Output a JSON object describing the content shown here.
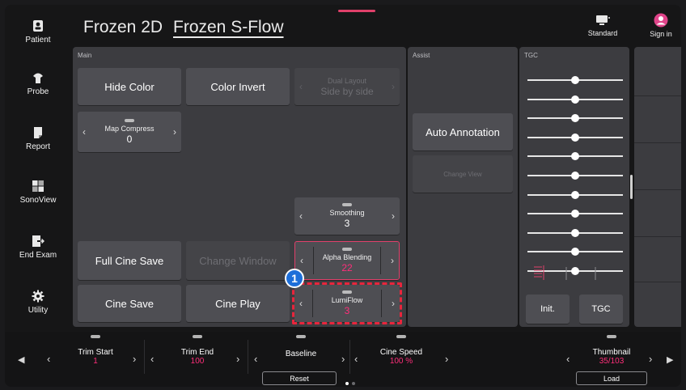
{
  "header": {
    "tabs": [
      {
        "label": "Frozen 2D",
        "active": false
      },
      {
        "label": "Frozen S-Flow",
        "active": true
      }
    ],
    "standard_label": "Standard",
    "signin_label": "Sign in"
  },
  "sidebar": {
    "items": [
      {
        "label": "Patient",
        "icon": "patient-icon"
      },
      {
        "label": "Probe",
        "icon": "probe-icon"
      },
      {
        "label": "Report",
        "icon": "report-icon"
      },
      {
        "label": "SonoView",
        "icon": "sonoview-icon"
      },
      {
        "label": "End Exam",
        "icon": "end-exam-icon"
      },
      {
        "label": "Utility",
        "icon": "gear-icon"
      }
    ]
  },
  "main": {
    "label": "Main",
    "hide_color": "Hide Color",
    "color_invert": "Color Invert",
    "dual_layout": {
      "label": "Dual Layout",
      "value": "Side by side"
    },
    "map_compress": {
      "label": "Map Compress",
      "value": "0"
    },
    "smoothing": {
      "label": "Smoothing",
      "value": "3"
    },
    "full_cine_save": "Full Cine Save",
    "change_window": "Change Window",
    "alpha_blending": {
      "label": "Alpha Blending",
      "value": "22"
    },
    "cine_save": "Cine Save",
    "cine_play": "Cine Play",
    "lumiflow": {
      "label": "LumiFlow",
      "value": "3"
    },
    "callout": "1"
  },
  "assist": {
    "label": "Assist",
    "auto_annotation": "Auto Annotation",
    "change_view": "Change View"
  },
  "tgc": {
    "label": "TGC",
    "levels": [
      0.5,
      0.5,
      0.5,
      0.5,
      0.5,
      0.5,
      0.5,
      0.5,
      0.5,
      0.5,
      0.5
    ],
    "init_label": "Init.",
    "tgc_button": "TGC"
  },
  "bottom": {
    "trim_start": {
      "label": "Trim Start",
      "value": "1"
    },
    "trim_end": {
      "label": "Trim End",
      "value": "100"
    },
    "baseline": {
      "label": "Baseline",
      "button": "Reset"
    },
    "cine_speed": {
      "label": "Cine Speed",
      "value": "100 %"
    },
    "thumbnail": {
      "label": "Thumbnail",
      "value": "35/103",
      "button": "Load"
    }
  },
  "colors": {
    "accent": "#ff2e7a",
    "callout": "#1e6fd9",
    "highlight": "#e8253c"
  }
}
